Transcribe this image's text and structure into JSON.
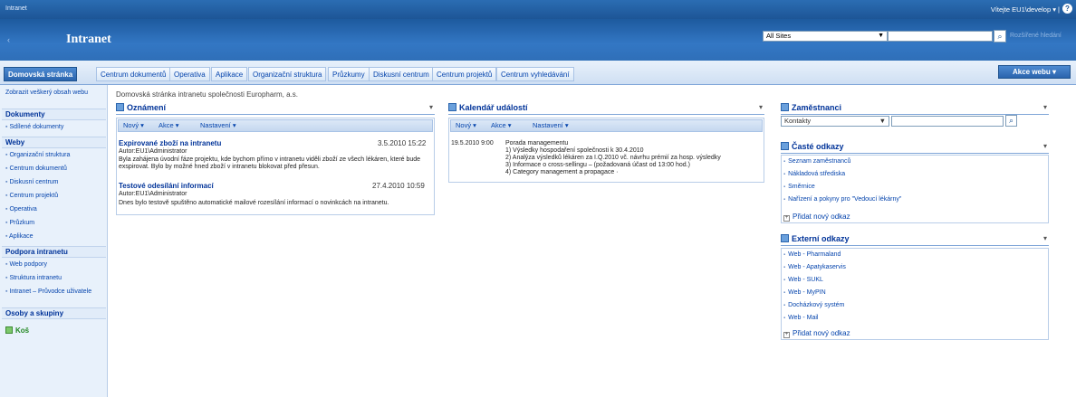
{
  "topbar": {
    "brand": "Intranet",
    "welcome": "Vítejte EU1\\develop ▾ |",
    "help": "?"
  },
  "header": {
    "title": "Intranet",
    "scope": "All Sites",
    "advanced_search": "Rozšířené hledání"
  },
  "tabs": [
    "Domovská stránka",
    "Centrum dokumentů",
    "Operativa",
    "Aplikace",
    "Organizační struktura",
    "Průzkumy",
    "Diskusní centrum",
    "Centrum projektů",
    "Centrum vyhledávání"
  ],
  "site_actions": "Akce webu ▾",
  "quicklaunch": {
    "view_all": "Zobrazit veškerý obsah webu",
    "documents_head": "Dokumenty",
    "documents": [
      "Sdílené dokumenty"
    ],
    "sites_head": "Weby",
    "sites": [
      "Organizační struktura",
      "Centrum dokumentů",
      "Diskusní centrum",
      "Centrum projektů",
      "Operativa",
      "Průzkum",
      "Aplikace"
    ],
    "support_head": "Podpora intranetu",
    "support": [
      "Web podpory",
      "Struktura intranetu",
      "Intranet – Průvodce uživatele"
    ],
    "people_head": "Osoby a skupiny",
    "trash": "Koš"
  },
  "description": "Domovská stránka intranetu společnosti Europharm, a.s.",
  "announcements": {
    "title": "Oznámení",
    "toolbar": [
      "Nový ▾",
      "Akce ▾",
      "Nastavení ▾"
    ],
    "items": [
      {
        "title": "Expirované zboží na intranetu",
        "date": "3.5.2010 15:22",
        "author": "Autor:EU1\\Administrator",
        "body": "Byla zahájena úvodní fáze projektu, kde bychom přímo v intranetu viděli zboží ze všech lékáren, které bude exspirovat. Bylo by možné hned zboží v intranetu blokovat před přesun."
      },
      {
        "title": "Testové odesílání informací",
        "date": "27.4.2010 10:59",
        "author": "Autor:EU1\\Administrator",
        "body": "Dnes bylo testově spuštěno automatické mailové rozesílání informací o novinkcách na intranetu."
      }
    ]
  },
  "calendar": {
    "title": "Kalendář událostí",
    "toolbar": [
      "Nový ▾",
      "Akce ▾",
      "Nastavení ▾"
    ],
    "event_date": "19.5.2010 9:00",
    "event_title": "Porada managementu",
    "event_lines": [
      "1) Výsledky hospodaření společnosti k 30.4.2010",
      "2) Analýza výsledků lékáren za I.Q.2010  vč. návrhu prémií za hosp. výsledky",
      "3) Informace o cross-sellingu – (požadovaná účast od 13:00 hod.)",
      "4) Category management a propagace ·"
    ]
  },
  "employees": {
    "title": "Zaměstnanci",
    "select": "Kontakty"
  },
  "frequent": {
    "title": "Časté odkazy",
    "links": [
      "Seznam zaměstnanců",
      "Nákladová střediska",
      "Směrnice",
      "Nařízení a pokyny pro \"Vedoucí lékárny\""
    ],
    "add": "Přidat nový odkaz"
  },
  "external": {
    "title": "Externí odkazy",
    "links": [
      "Web - Pharmaland",
      "Web - Apatykaservis",
      "Web - SUKL",
      "Web - MyPIN",
      "Docházkový systém",
      "Web - Mail"
    ],
    "add": "Přidat nový odkaz"
  },
  "colors": {
    "accent": "#2a64ad",
    "link": "#0645ad",
    "heading": "#003399",
    "trash": "#228822"
  }
}
